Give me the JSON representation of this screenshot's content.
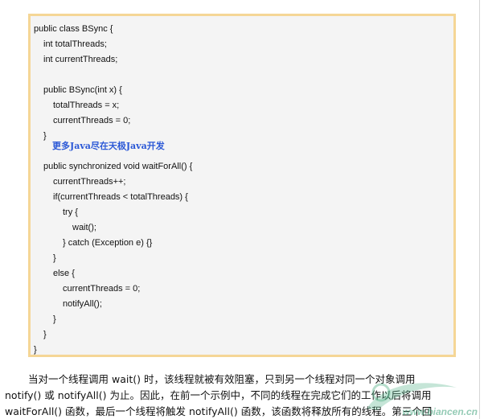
{
  "code_block": {
    "lines": [
      {
        "text": "public class BSync {",
        "indent": 0
      },
      {
        "text": "int totalThreads;",
        "indent": 1
      },
      {
        "text": "int currentThreads;",
        "indent": 1
      },
      {
        "text": "",
        "indent": 0
      },
      {
        "text": "public BSync(int x) {",
        "indent": 1
      },
      {
        "text": "totalThreads = x;",
        "indent": 2
      },
      {
        "text": "currentThreads = 0;",
        "indent": 2
      },
      {
        "text": "}",
        "indent": 1
      },
      {
        "text": "",
        "indent": 0
      },
      {
        "text": "public synchronized void waitForAll() {",
        "indent": 1
      },
      {
        "text": "currentThreads++;",
        "indent": 2
      },
      {
        "text": "if(currentThreads < totalThreads) {",
        "indent": 2
      },
      {
        "text": "try {",
        "indent": 3
      },
      {
        "text": "wait();",
        "indent": 4
      },
      {
        "text": "} catch (Exception e) {}",
        "indent": 3
      },
      {
        "text": "}",
        "indent": 2
      },
      {
        "text": "else {",
        "indent": 2
      },
      {
        "text": "currentThreads = 0;",
        "indent": 3
      },
      {
        "text": "notifyAll();",
        "indent": 3
      },
      {
        "text": "}",
        "indent": 2
      },
      {
        "text": "}",
        "indent": 1
      },
      {
        "text": "}",
        "indent": 0
      }
    ],
    "link_text": "更多Java尽在天极Java开发"
  },
  "paragraph": {
    "lines": [
      "当对一个线程调用  wait() 时，该线程就被有效阻塞，只到另一个线程对同一个对象调用",
      "notify() 或  notifyAll() 为止。因此，在前一个示例中，不同的线程在完成它们的工作以后将调用",
      "waitForAll() 函数，最后一个线程将触发  notifyAll() 函数，该函数将释放所有的线程。第三个回"
    ]
  },
  "watermark": {
    "text": "www.biancen.cn"
  },
  "colors": {
    "code_background": "#f4f4f4",
    "code_border": "#f5d696",
    "link": "#2b58d6",
    "text": "#111111"
  }
}
